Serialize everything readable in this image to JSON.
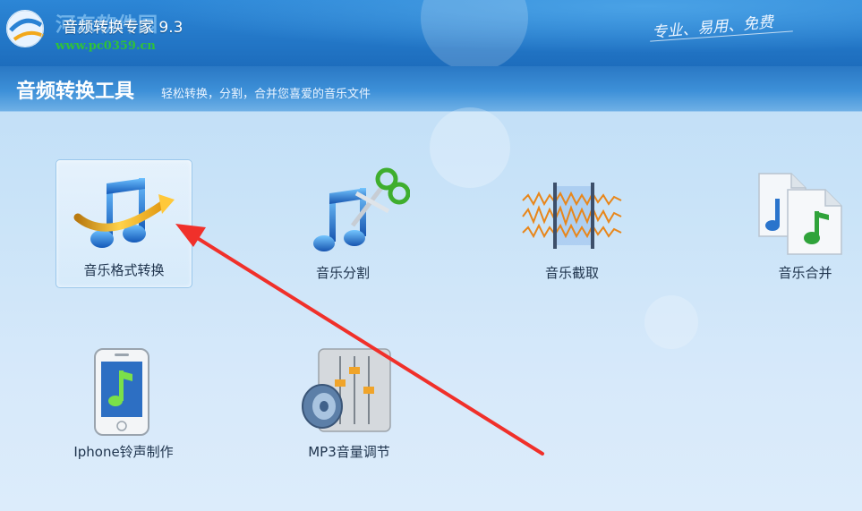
{
  "window": {
    "app_title": "音频转换专家 9.3",
    "watermark": "河东软件园",
    "watermark_url": "www.pc0359.cn",
    "slogan": "专业、易用、免费"
  },
  "header": {
    "title": "音频转换工具",
    "subtitle": "轻松转换，分割，合并您喜爱的音乐文件"
  },
  "tools": [
    {
      "label": "音乐格式转换",
      "icon": "music-note-convert-icon",
      "selected": true
    },
    {
      "label": "音乐分割",
      "icon": "music-note-scissors-icon"
    },
    {
      "label": "音乐截取",
      "icon": "waveform-cut-icon"
    },
    {
      "label": "音乐合并",
      "icon": "music-files-merge-icon"
    },
    {
      "label": "Iphone铃声制作",
      "icon": "iphone-ringtone-icon"
    },
    {
      "label": "MP3音量调节",
      "icon": "mixer-speaker-icon"
    }
  ],
  "colors": {
    "titlebar": "#1d6dbd",
    "background": "#c9e3f8",
    "annotation_arrow": "#f0302a",
    "watermark_url": "#2fc13a"
  }
}
